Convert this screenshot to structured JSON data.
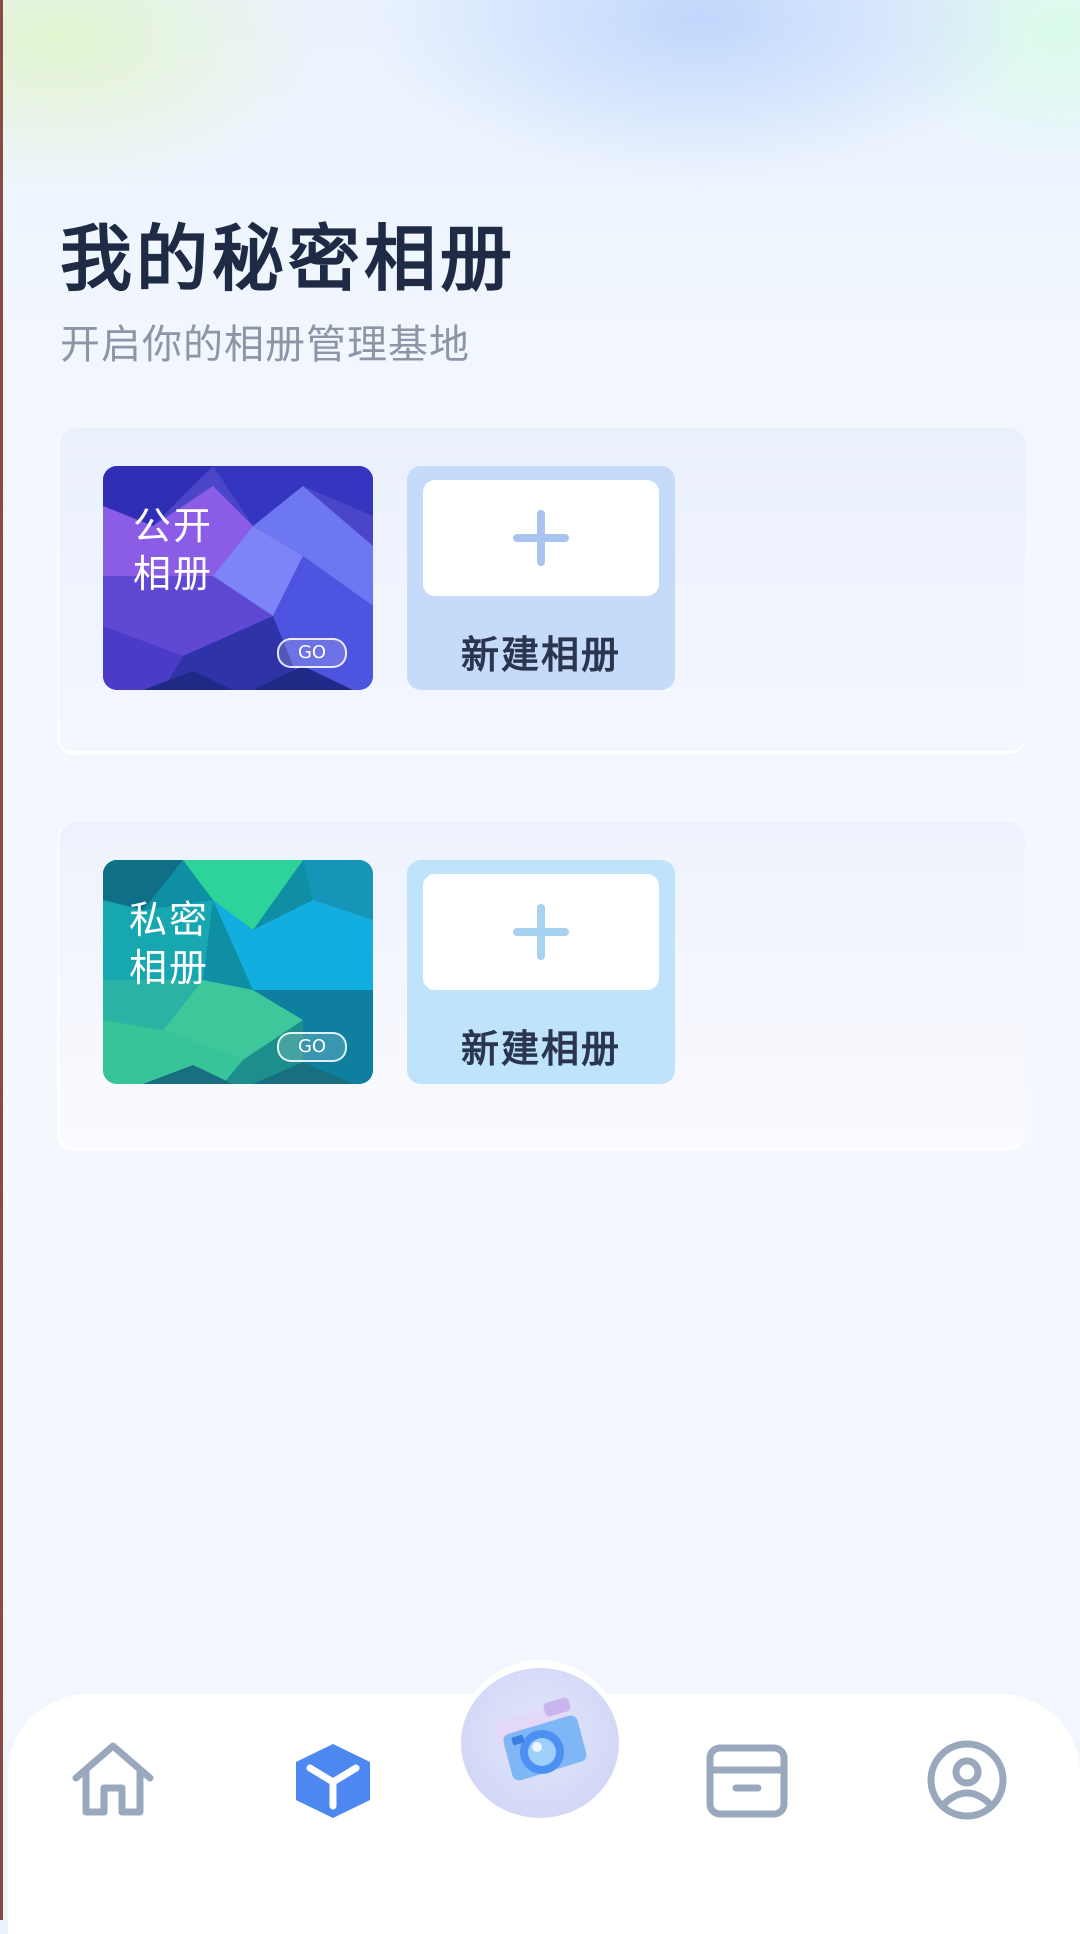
{
  "header": {
    "title": "我的秘密相册",
    "subtitle": "开启你的相册管理基地"
  },
  "sections": [
    {
      "cover_label": "公开\n相册",
      "go_label": "GO",
      "new_album_label": "新建相册"
    },
    {
      "cover_label": "私密\n相册",
      "go_label": "GO",
      "new_album_label": "新建相册"
    }
  ],
  "tabbar": {
    "items": [
      {
        "icon": "home-icon",
        "active": false
      },
      {
        "icon": "cube-icon",
        "active": true
      },
      {
        "icon": "camera-icon",
        "active": false
      },
      {
        "icon": "box-icon",
        "active": false
      },
      {
        "icon": "user-icon",
        "active": false
      }
    ]
  },
  "colors": {
    "title": "#1f2b45",
    "subtitle": "#8d96a6",
    "active_tab": "#4d87f0",
    "inactive_tab": "#9aa8bd",
    "public_cover": "#5b54d8",
    "private_cover": "#18a4a0"
  }
}
